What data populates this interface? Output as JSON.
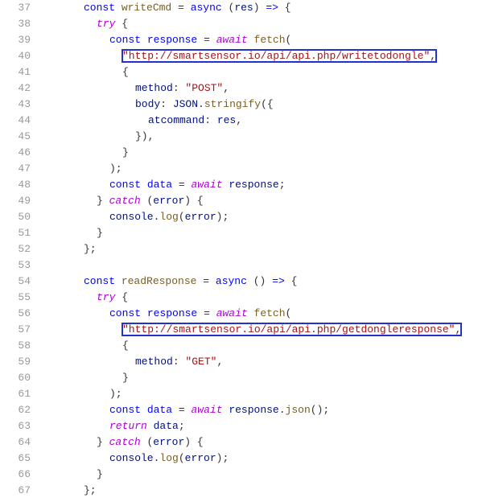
{
  "colors": {
    "keyword_blue": "#0000ff",
    "keyword_purple": "#af00db",
    "function_yellow": "#795e26",
    "number_green": "#098658",
    "string_red": "#a31515",
    "highlight_border": "#2233cc"
  },
  "first_line_no": 37,
  "tokens": {
    "const": "const",
    "writeCmd": "writeCmd",
    "readResponse": "readResponse",
    "async": "async",
    "arrow": "=>",
    "try": "try",
    "catch": "catch",
    "await": "await",
    "fetch": "fetch",
    "return": "return",
    "response": "response",
    "data": "data",
    "error": "error",
    "console": "console",
    "log": "log",
    "json": "json",
    "JSON": "JSON",
    "stringify": "stringify",
    "method": "method",
    "body": "body",
    "atcommand": "atcommand",
    "res": "res",
    "eq": "=",
    "paren_o": "(",
    "paren_c": ")",
    "brace_o": "{",
    "brace_c": "}",
    "brace_c_paren": "})",
    "paren_semi": ");",
    "semi": ";",
    "comma": ",",
    "colon": ":",
    "dot": "."
  },
  "strings": {
    "url_write": "\"http://smartsensor.io/api/api.php/writetodongle\"",
    "url_read": "\"http://smartsensor.io/api/api.php/getdongleresponse\"",
    "POST": "\"POST\"",
    "GET": "\"GET\""
  },
  "chart_data": null
}
